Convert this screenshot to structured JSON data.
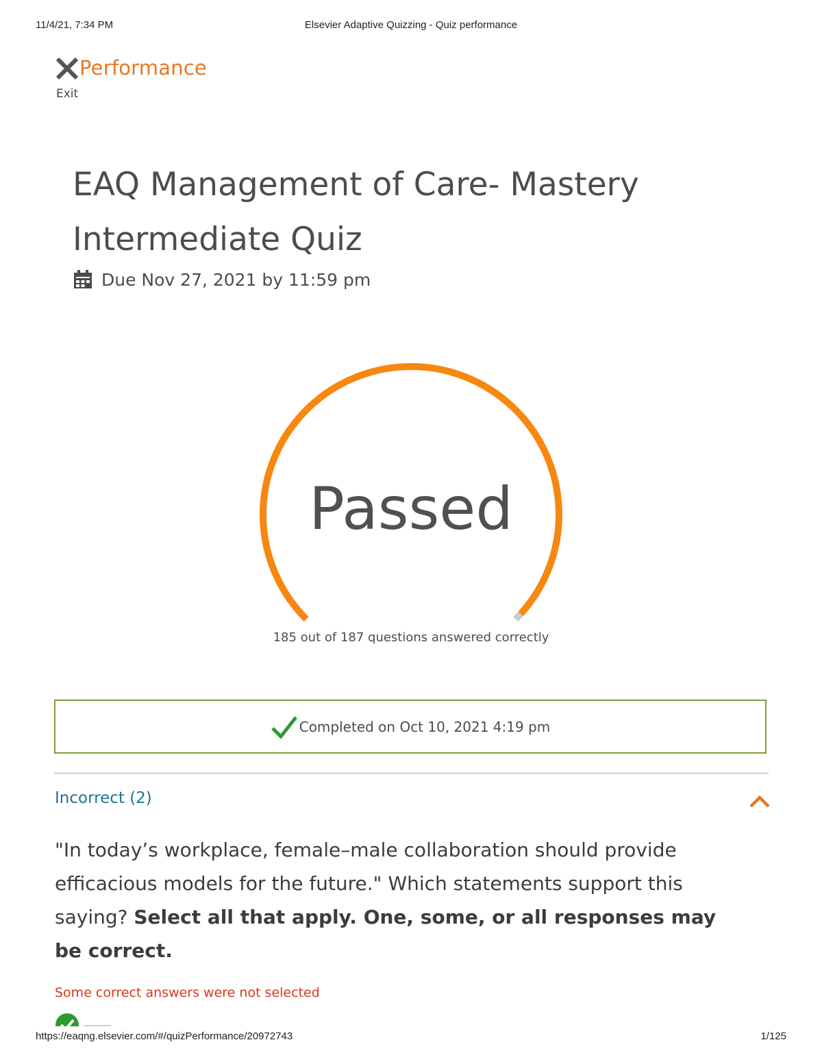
{
  "browser_print": {
    "timestamp": "11/4/21, 7:34 PM",
    "page_title": "Elsevier Adaptive Quizzing - Quiz performance",
    "url": "https://eaqng.elsevier.com/#/quizPerformance/20972743",
    "page_count": "1/125"
  },
  "header": {
    "close_icon": "close-x-icon",
    "title": "Performance",
    "exit_label": "Exit"
  },
  "quiz": {
    "title": "EAQ Management of Care- Mastery Intermediate Quiz",
    "due_icon": "calendar-icon",
    "due_text": "Due Nov 27, 2021 by 11:59 pm"
  },
  "result": {
    "status": "Passed",
    "correct": 185,
    "total": 187,
    "score_text": "185 out of 187 questions answered correctly",
    "gauge_color": "#f7870f",
    "gauge_remainder_color": "#cccccc"
  },
  "completion": {
    "check_icon": "checkmark-icon",
    "text": "Completed on Oct 10, 2021 4:19 pm",
    "border_color": "#7aa03a"
  },
  "incorrect_section": {
    "label": "Incorrect (2)",
    "chevron_icon": "chevron-up-icon",
    "question_text": "\"In today’s workplace, female–male collaboration should provide efficacious models for the future.\" Which statements support this saying?",
    "instructions": "Select all that apply. One, some, or all responses may be correct.",
    "feedback": "Some correct answers were not selected",
    "answer_icon": "correct-answer-icon"
  }
}
